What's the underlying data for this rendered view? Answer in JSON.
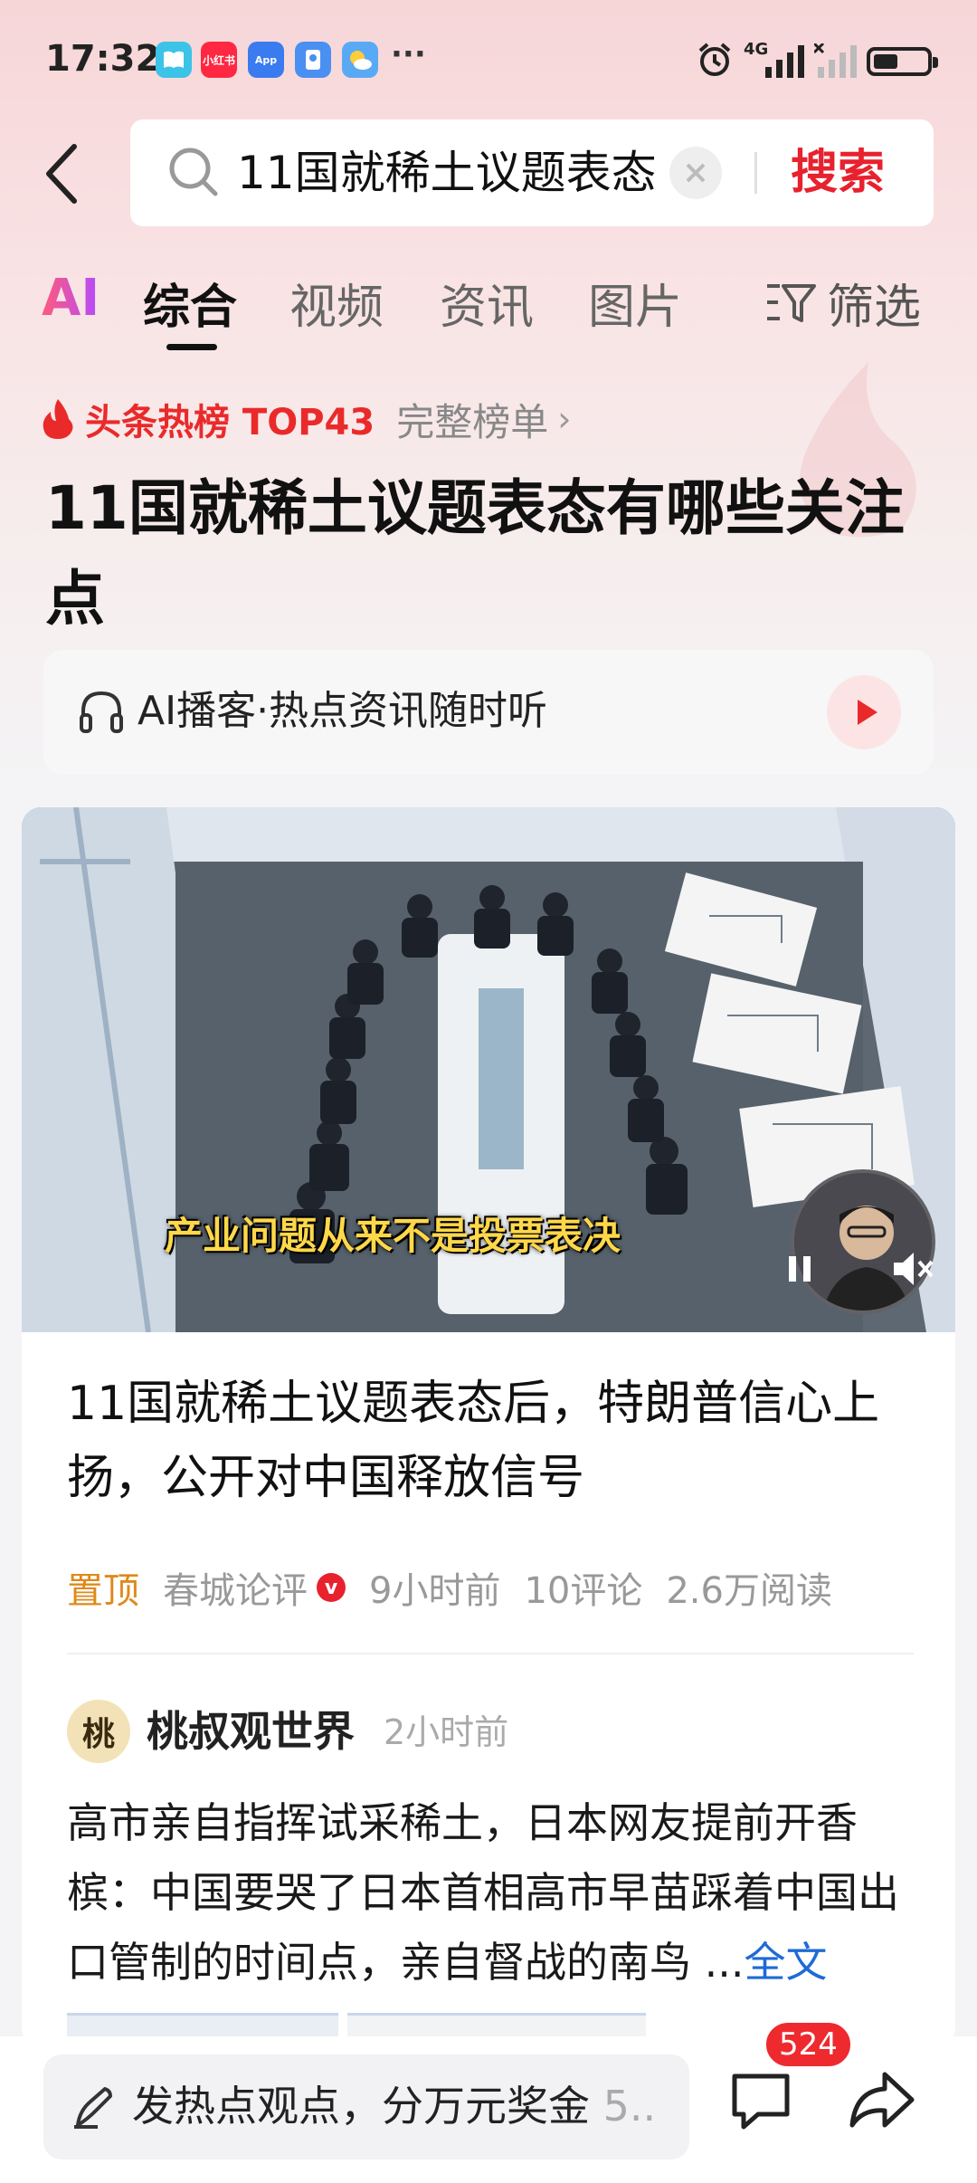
{
  "status_bar": {
    "time": "17:32",
    "apps": [
      {
        "name": "book-app-icon",
        "color": "#3cc3e8",
        "label": ""
      },
      {
        "name": "xiaohongshu-app-icon",
        "color": "#ff2741",
        "label": "小红书"
      },
      {
        "name": "app-market-icon",
        "color": "#3a7bf0",
        "label": "App"
      },
      {
        "name": "key-app-icon",
        "color": "#4a8ff2",
        "label": ""
      },
      {
        "name": "weather-app-icon",
        "color": "#5aa9f5",
        "label": ""
      }
    ],
    "more": "···",
    "network": "4G"
  },
  "search": {
    "query": "11国就稀土议题表态",
    "submit_label": "搜索"
  },
  "tabs": {
    "ai": "AI",
    "items": [
      "综合",
      "视频",
      "资讯",
      "图片"
    ],
    "filter": "筛选"
  },
  "hot": {
    "label": "头条热榜 TOP43",
    "full_list": "完整榜单",
    "title": "11国就稀土议题表态有哪些关注点"
  },
  "podcast": {
    "text": "AI播客·热点资讯随时听"
  },
  "article": {
    "video_caption": "产业问题从来不是投票表决",
    "title": "11国就稀土议题表态后，特朗普信心上扬，公开对中国释放信号",
    "pinned": "置顶",
    "source": "春城论评",
    "verified": "v",
    "time": "9小时前",
    "comments": "10评论",
    "reads": "2.6万阅读"
  },
  "post": {
    "author": "桃叔观世界",
    "avatar_text": "桃",
    "time": "2小时前",
    "body": "高市亲自指挥试采稀土，日本网友提前开香槟：中国要哭了日本首相高市早苗踩着中国出口管制的时间点，亲自督战的南鸟 ...",
    "more": "全文"
  },
  "bottom": {
    "compose": "发热点观点，分万元奖金",
    "compose_tail": "5..",
    "comment_count": "524"
  },
  "colors": {
    "accent_red": "#e8212e",
    "pin_orange": "#e0891a",
    "link_blue": "#1e6bd6"
  }
}
